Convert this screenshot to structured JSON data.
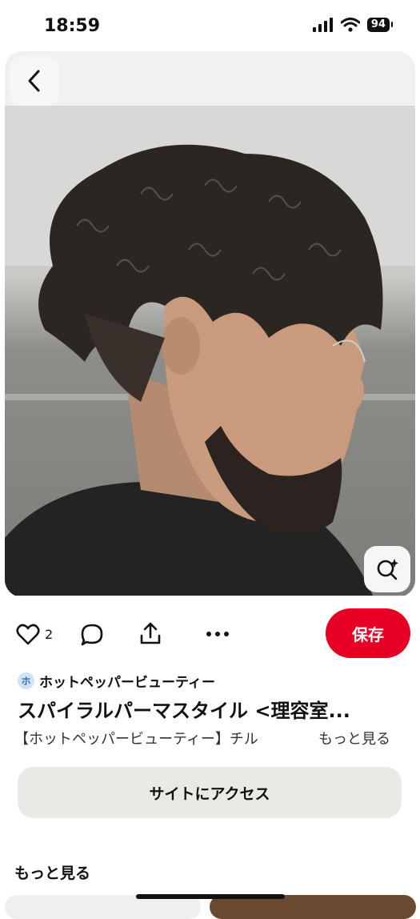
{
  "status_bar": {
    "time": "18:59",
    "battery": "94"
  },
  "pin": {
    "like_count": "2",
    "save_label": "保存",
    "source_initial": "ホ",
    "source_name": "ホットペッパービューティー",
    "title": "スパイラルパーマスタイル <理容室...",
    "description": "【ホットペッパービューティー】チル",
    "more_label": "もっと見る",
    "visit_label": "サイトにアクセス"
  },
  "more_section": {
    "heading": "もっと見る"
  },
  "icons": {
    "back": "chevron-left-icon",
    "lens": "visual-search-icon",
    "like": "heart-icon",
    "comment": "comment-icon",
    "share": "share-icon",
    "more": "more-icon"
  },
  "colors": {
    "accent": "#e60023",
    "card_bg": "#f1f1f1",
    "visit_bg": "#e9e9e6"
  }
}
